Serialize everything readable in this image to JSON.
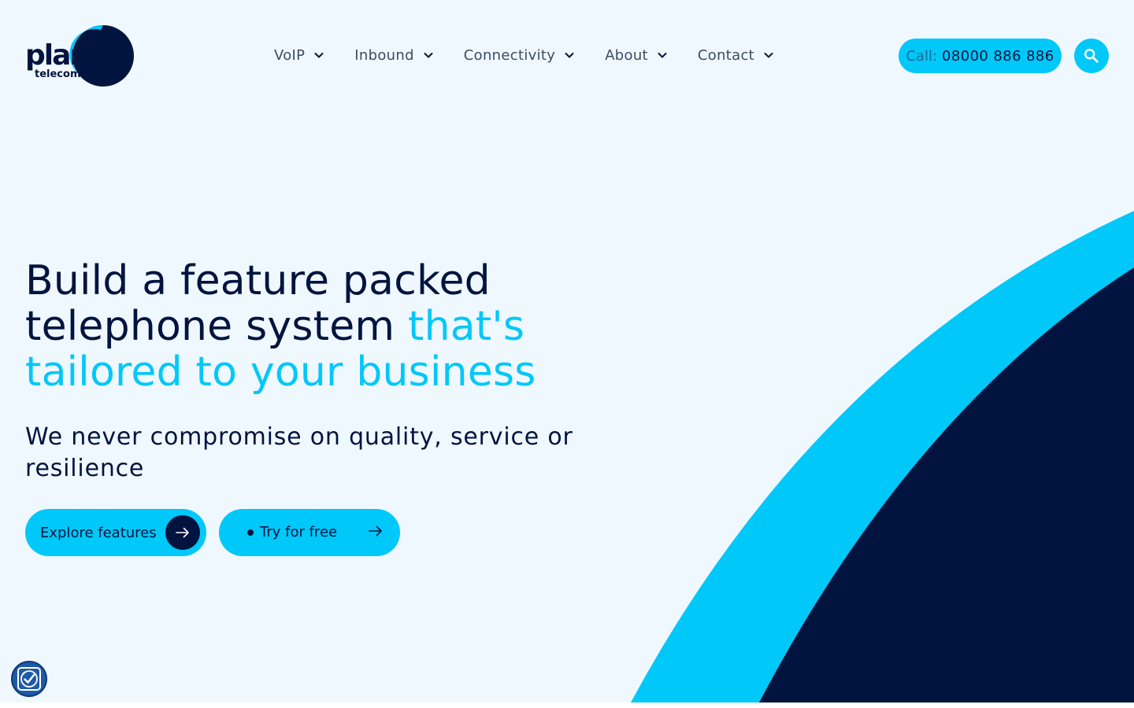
{
  "brand": {
    "logo_text_main": "planet",
    "logo_text_sub": "telecom",
    "colors": {
      "navy": "#00143f",
      "cyan": "#00c8f8",
      "background": "#f0f8ff"
    }
  },
  "nav": {
    "items": [
      {
        "label": "VoIP",
        "icon": "chevron-down-icon"
      },
      {
        "label": "Inbound",
        "icon": "chevron-down-icon"
      },
      {
        "label": "Connectivity",
        "icon": "chevron-down-icon"
      },
      {
        "label": "About",
        "icon": "chevron-down-icon"
      },
      {
        "label": "Contact",
        "icon": "chevron-down-icon"
      }
    ]
  },
  "header": {
    "call_prefix": "Call:",
    "call_number": "08000 886 886",
    "search_icon": "search-icon"
  },
  "hero": {
    "title_part1": "Build a feature packed telephone system ",
    "title_highlight": "that's tailored to your business",
    "subtitle": "We never compromise on quality, service or resilience",
    "primary_cta": "Explore features",
    "secondary_cta": "Try for free"
  },
  "widgets": {
    "accessibility_icon": "accessibility-icon"
  }
}
